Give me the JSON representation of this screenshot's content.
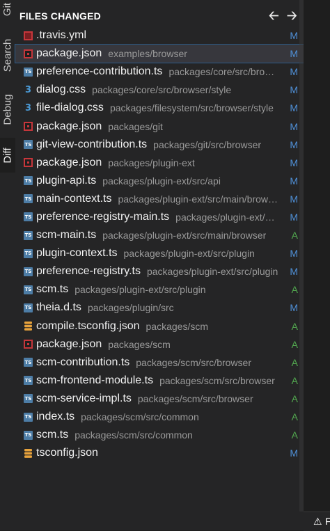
{
  "activity_tabs": [
    "Git",
    "Search",
    "Debug",
    "Diff"
  ],
  "header": {
    "title": "FILES CHANGED",
    "prev_icon": "arrow-left-icon",
    "next_icon": "arrow-right-icon"
  },
  "files": [
    {
      "icon": "yml",
      "name": ".travis.yml",
      "path": "",
      "status": "M"
    },
    {
      "icon": "npm",
      "name": "package.json",
      "path": "examples/browser",
      "status": "M",
      "selected": true
    },
    {
      "icon": "ts",
      "name": "preference-contribution.ts",
      "path": "packages/core/src/bro…",
      "status": "M"
    },
    {
      "icon": "css",
      "name": "dialog.css",
      "path": "packages/core/src/browser/style",
      "status": "M"
    },
    {
      "icon": "css",
      "name": "file-dialog.css",
      "path": "packages/filesystem/src/browser/style",
      "status": "M"
    },
    {
      "icon": "npm",
      "name": "package.json",
      "path": "packages/git",
      "status": "M"
    },
    {
      "icon": "ts",
      "name": "git-view-contribution.ts",
      "path": "packages/git/src/browser",
      "status": "M"
    },
    {
      "icon": "npm",
      "name": "package.json",
      "path": "packages/plugin-ext",
      "status": "M"
    },
    {
      "icon": "ts",
      "name": "plugin-api.ts",
      "path": "packages/plugin-ext/src/api",
      "status": "M"
    },
    {
      "icon": "ts",
      "name": "main-context.ts",
      "path": "packages/plugin-ext/src/main/brow…",
      "status": "M"
    },
    {
      "icon": "ts",
      "name": "preference-registry-main.ts",
      "path": "packages/plugin-ext/…",
      "status": "M"
    },
    {
      "icon": "ts",
      "name": "scm-main.ts",
      "path": "packages/plugin-ext/src/main/browser",
      "status": "A"
    },
    {
      "icon": "ts",
      "name": "plugin-context.ts",
      "path": "packages/plugin-ext/src/plugin",
      "status": "M"
    },
    {
      "icon": "ts",
      "name": "preference-registry.ts",
      "path": "packages/plugin-ext/src/plugin",
      "status": "M"
    },
    {
      "icon": "ts",
      "name": "scm.ts",
      "path": "packages/plugin-ext/src/plugin",
      "status": "A"
    },
    {
      "icon": "ts",
      "name": "theia.d.ts",
      "path": "packages/plugin/src",
      "status": "M"
    },
    {
      "icon": "cfg",
      "name": "compile.tsconfig.json",
      "path": "packages/scm",
      "status": "A"
    },
    {
      "icon": "npm",
      "name": "package.json",
      "path": "packages/scm",
      "status": "A"
    },
    {
      "icon": "ts",
      "name": "scm-contribution.ts",
      "path": "packages/scm/src/browser",
      "status": "A"
    },
    {
      "icon": "ts",
      "name": "scm-frontend-module.ts",
      "path": "packages/scm/src/browser",
      "status": "A"
    },
    {
      "icon": "ts",
      "name": "scm-service-impl.ts",
      "path": "packages/scm/src/browser",
      "status": "A"
    },
    {
      "icon": "ts",
      "name": "index.ts",
      "path": "packages/scm/src/common",
      "status": "A"
    },
    {
      "icon": "ts",
      "name": "scm.ts",
      "path": "packages/scm/src/common",
      "status": "A"
    },
    {
      "icon": "cfg",
      "name": "tsconfig.json",
      "path": "",
      "status": "M"
    }
  ],
  "bottom_bar": {
    "icon": "warning-icon",
    "letter": "F"
  },
  "colors": {
    "modified": "#4f8fd6",
    "added": "#52a84f",
    "ts_icon": "#4d7da6",
    "npm_icon": "#c7363b",
    "css_icon": "#4b9ad6",
    "json_icon": "#e8a33c"
  }
}
